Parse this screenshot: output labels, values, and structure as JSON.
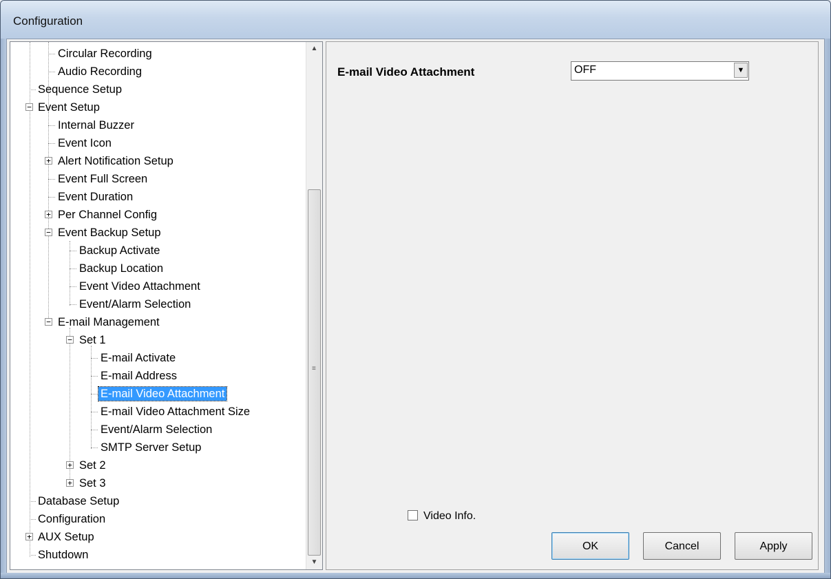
{
  "window": {
    "title": "Configuration"
  },
  "tree": {
    "items": [
      {
        "label": "Circular Recording"
      },
      {
        "label": "Audio Recording"
      },
      {
        "label": "Sequence Setup"
      },
      {
        "label": "Event Setup"
      },
      {
        "label": "Internal Buzzer"
      },
      {
        "label": "Event Icon"
      },
      {
        "label": "Alert Notification Setup"
      },
      {
        "label": "Event Full Screen"
      },
      {
        "label": "Event Duration"
      },
      {
        "label": "Per Channel Config"
      },
      {
        "label": "Event Backup Setup"
      },
      {
        "label": "Backup Activate"
      },
      {
        "label": "Backup Location"
      },
      {
        "label": "Event Video Attachment"
      },
      {
        "label": "Event/Alarm Selection"
      },
      {
        "label": "E-mail Management"
      },
      {
        "label": "Set 1"
      },
      {
        "label": "E-mail Activate"
      },
      {
        "label": "E-mail Address"
      },
      {
        "label": "E-mail Video Attachment"
      },
      {
        "label": "E-mail Video Attachment Size"
      },
      {
        "label": "Event/Alarm Selection"
      },
      {
        "label": "SMTP Server Setup"
      },
      {
        "label": "Set 2"
      },
      {
        "label": "Set 3"
      },
      {
        "label": "Database Setup"
      },
      {
        "label": "Configuration"
      },
      {
        "label": "AUX Setup"
      },
      {
        "label": "Shutdown"
      }
    ]
  },
  "settings": {
    "field_label": "E-mail Video Attachment",
    "combo_value": "OFF",
    "video_info_label": "Video Info.",
    "video_info_checked": false
  },
  "buttons": {
    "ok": "OK",
    "cancel": "Cancel",
    "apply": "Apply"
  }
}
